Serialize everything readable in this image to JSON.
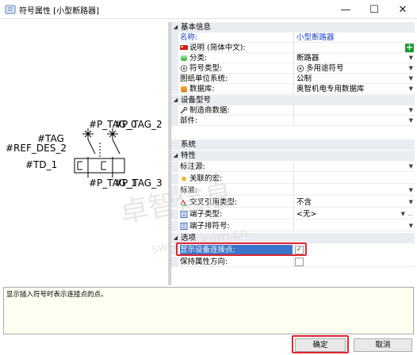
{
  "window": {
    "title": "符号属性 [小型断路器]",
    "controls": {
      "minimize": "—",
      "maximize": "☐",
      "close": "✕"
    }
  },
  "preview": {
    "labels": {
      "tag": "#TAG",
      "ref_des": "#REF_DES_2",
      "td": "#TD_1",
      "top_left": "#P_TAG_0",
      "top_right": "#P_TAG_2",
      "bottom_left": "#P_TAG_1",
      "bottom_right": "#P_TAG_3"
    }
  },
  "grid": {
    "categories": {
      "basic": "基本信息",
      "device_model": "设备型号",
      "system": "系统",
      "characteristics": "特性",
      "options": "选项"
    },
    "rows": {
      "name": {
        "label": "名称:",
        "value": "小型断路器"
      },
      "description": {
        "label": "说明 (简体中文):",
        "value": ""
      },
      "class": {
        "label": "分类:",
        "value": "断路器"
      },
      "symbol_type": {
        "label": "符号类型:",
        "value": "多用途符号"
      },
      "drawing_units": {
        "label": "图纸单位系统:",
        "value": "公制"
      },
      "database": {
        "label": "数据库:",
        "value": "奥智机电专用数据库"
      },
      "manufacturer": {
        "label": "制造商数据:",
        "value": ""
      },
      "part": {
        "label": "部件:",
        "value": ""
      },
      "annotation_source": {
        "label": "标注源:",
        "value": ""
      },
      "linked_macro": {
        "label": "关联的宏:",
        "value": ""
      },
      "standard": {
        "label": "标准:",
        "value": ""
      },
      "cross_ref_type": {
        "label": "交叉引用类型:",
        "value": "不含"
      },
      "terminal_type": {
        "label": "端子类型:",
        "value": "<无>"
      },
      "terminal_order": {
        "label": "端子排符号:",
        "value": ""
      },
      "show_connection_points": {
        "label": "显示设备连接点:",
        "checked": "✓"
      },
      "keep_orientation": {
        "label": "保持属性方向:",
        "checked": ""
      }
    }
  },
  "description_pane": {
    "text": "显示插入符号时表示连接点的点。"
  },
  "buttons": {
    "ok": "确定",
    "cancel": "取消"
  },
  "watermark": {
    "line1": "卓智信息",
    "line2": "sw-elec.com.cn"
  },
  "colors": {
    "selected_row": "#3b74c8",
    "highlight": "#e0262f",
    "category_bg": "#e9ecf1",
    "description_bg": "#fffff1",
    "add_button": "#1e9c36"
  },
  "icons": {
    "title": "symbol-properties-icon",
    "description": "flag-icon",
    "class": "class-cube-icon",
    "symbol_type": "symbol-type-icon",
    "database": "database-icon",
    "manufacturer": "wrench-icon",
    "linked_macro": "star-icon",
    "cross_ref_type": "cross-reference-icon",
    "terminal_type": "terminal-icon",
    "terminal_order": "terminal-order-icon"
  }
}
